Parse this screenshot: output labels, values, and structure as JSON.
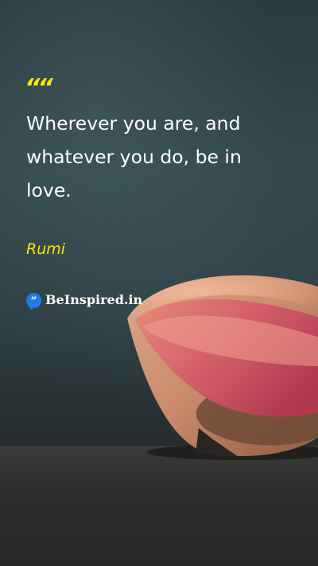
{
  "quote": {
    "mark": "““",
    "text": "Wherever you are, and whatever you do, be in love.",
    "author": "Rumi"
  },
  "brand": {
    "icon": "quote-bubble-icon",
    "name": "BeInspired.in"
  },
  "colors": {
    "accent": "#ffe600",
    "text": "#ffffff",
    "brand_icon": "#1e7ee8"
  }
}
